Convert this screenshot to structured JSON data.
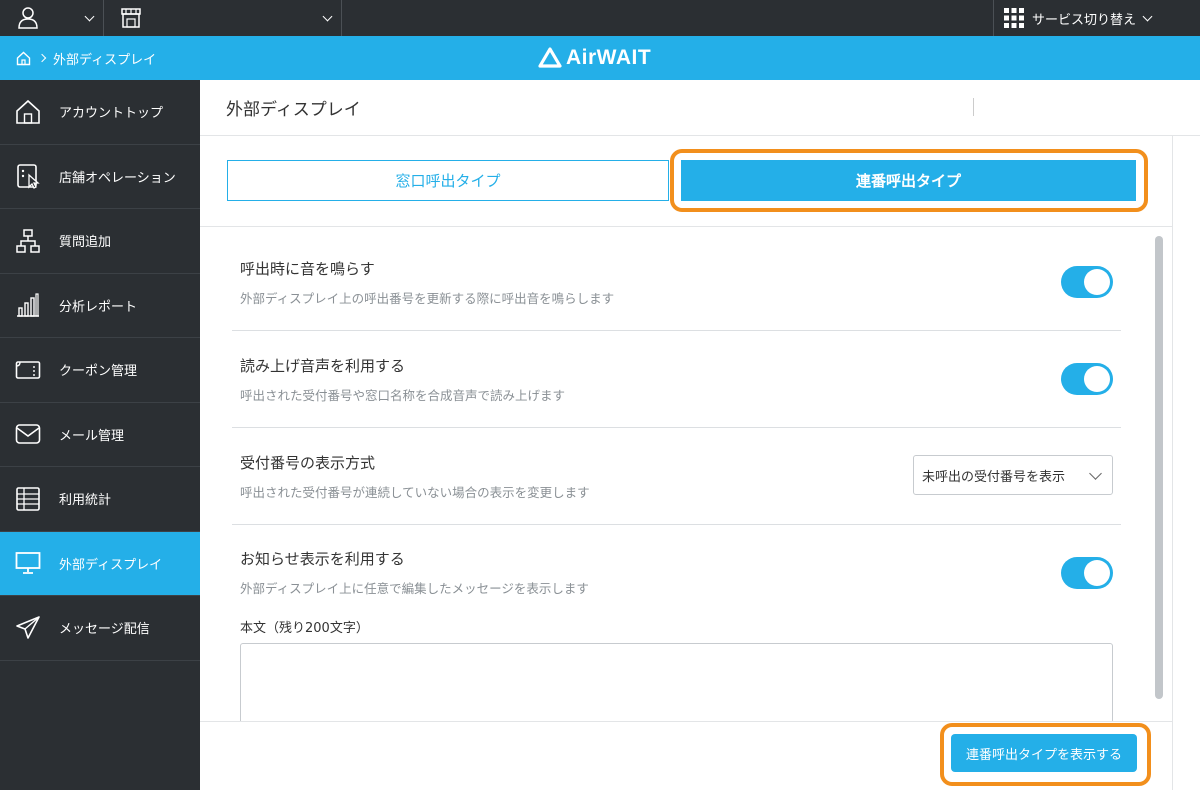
{
  "topbar": {
    "user_icon": "user-icon",
    "store_icon": "store-icon",
    "service_icon": "grid-icon",
    "service_label": "サービス切り替え"
  },
  "header": {
    "breadcrumb_home_icon": "home-icon",
    "breadcrumb_current": "外部ディスプレイ",
    "logo_text": "AirWAIT",
    "brand_color": "#24afe8"
  },
  "sidebar": {
    "items": [
      {
        "label": "アカウントトップ",
        "icon": "home-icon"
      },
      {
        "label": "店舗オペレーション",
        "icon": "tablet-touch-icon"
      },
      {
        "label": "質問追加",
        "icon": "hierarchy-icon"
      },
      {
        "label": "分析レポート",
        "icon": "bar-chart-icon"
      },
      {
        "label": "クーポン管理",
        "icon": "coupon-icon"
      },
      {
        "label": "メール管理",
        "icon": "mail-icon"
      },
      {
        "label": "利用統計",
        "icon": "table-icon"
      },
      {
        "label": "外部ディスプレイ",
        "icon": "monitor-icon",
        "active": true
      },
      {
        "label": "メッセージ配信",
        "icon": "paper-plane-icon"
      }
    ]
  },
  "main": {
    "page_title": "外部ディスプレイ",
    "tabs": [
      {
        "label": "窓口呼出タイプ",
        "selected": false
      },
      {
        "label": "連番呼出タイプ",
        "selected": true
      }
    ],
    "settings": [
      {
        "title": "呼出時に音を鳴らす",
        "description": "外部ディスプレイ上の呼出番号を更新する際に呼出音を鳴らします",
        "enabled": true
      },
      {
        "title": "読み上げ音声を利用する",
        "description": "呼出された受付番号や窓口名称を合成音声で読み上げます",
        "enabled": true
      },
      {
        "title": "受付番号の表示方式",
        "description": "呼出された受付番号が連続していない場合の表示を変更します",
        "select_value": "未呼出の受付番号を表示"
      },
      {
        "title": "お知らせ表示を利用する",
        "description": "外部ディスプレイ上に任意で編集したメッセージを表示します",
        "enabled": true
      }
    ],
    "body_label": "本文（残り200文字）",
    "body_value": "",
    "save_button": "連番呼出タイプを表示する",
    "highlight_color": "#f28f1c"
  }
}
